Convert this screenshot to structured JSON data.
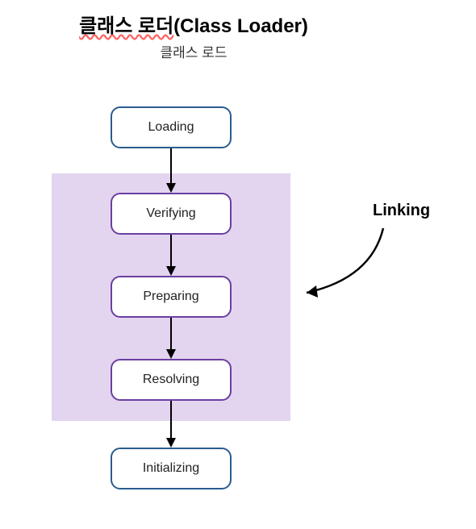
{
  "header": {
    "title_kr": "클래스 로더",
    "title_en": "(Class Loader)",
    "subtitle": "클래스 로드"
  },
  "nodes": {
    "loading": "Loading",
    "verifying": "Verifying",
    "preparing": "Preparing",
    "resolving": "Resolving",
    "initializing": "Initializing"
  },
  "labels": {
    "linking": "Linking"
  }
}
